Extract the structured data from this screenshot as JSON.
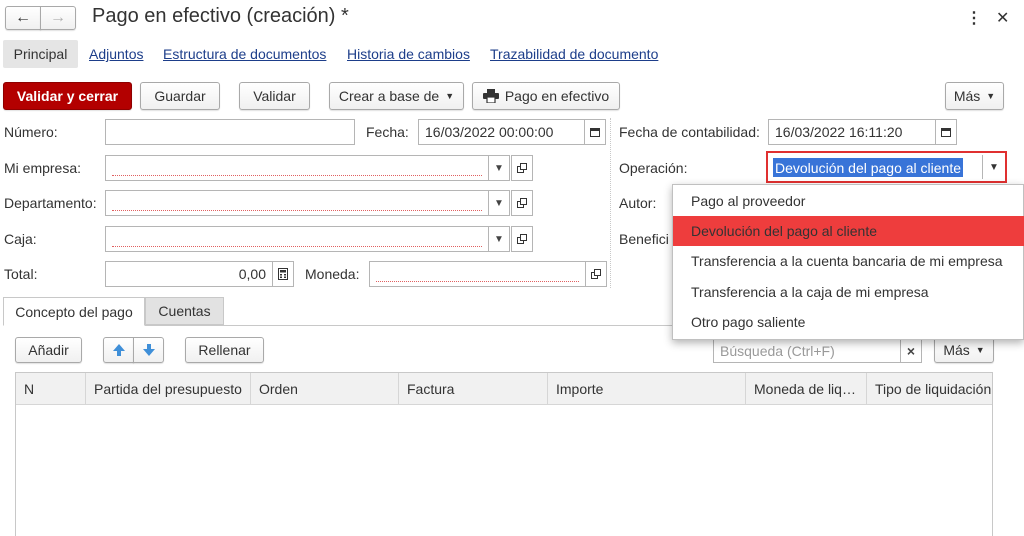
{
  "window": {
    "title": "Pago en efectivo (creación) *",
    "more_icon": "⋮",
    "close_icon": "✕"
  },
  "nav": {
    "back_icon": "←",
    "forward_icon": "→"
  },
  "tabs": [
    {
      "label": "Principal",
      "active": true
    },
    {
      "label": "Adjuntos"
    },
    {
      "label": "Estructura de documentos"
    },
    {
      "label": "Historia de cambios"
    },
    {
      "label": "Trazabilidad de documento"
    }
  ],
  "toolbar": {
    "validate_close": "Validar y cerrar",
    "save": "Guardar",
    "validate": "Validar",
    "create_based": "Crear a base de",
    "print_label": "Pago en efectivo",
    "more": "Más"
  },
  "form": {
    "numero_label": "Número:",
    "numero_value": "",
    "fecha_label": "Fecha:",
    "fecha_value": "16/03/2022 00:00:00",
    "empresa_label": "Mi empresa:",
    "departamento_label": "Departamento:",
    "caja_label": "Caja:",
    "total_label": "Total:",
    "total_value": "0,00",
    "moneda_label": "Moneda:",
    "fecha_contab_label": "Fecha de contabilidad:",
    "fecha_contab_value": "16/03/2022 16:11:20",
    "operacion_label": "Operación:",
    "operacion_value": "Devolución del pago al cliente",
    "autor_label": "Autor:",
    "beneficiario_label": "Benefici"
  },
  "dropdown": {
    "items": [
      "Pago al proveedor",
      "Devolución del pago al cliente",
      "Transferencia a la cuenta bancaria de mi empresa",
      "Transferencia a la caja de mi empresa",
      "Otro pago saliente"
    ],
    "selected_index": 1
  },
  "lower_tabs": [
    {
      "label": "Concepto del pago",
      "active": true
    },
    {
      "label": "Cuentas"
    }
  ],
  "table_toolbar": {
    "add": "Añadir",
    "fill": "Rellenar",
    "search_placeholder": "Búsqueda (Ctrl+F)",
    "clear_icon": "×",
    "more": "Más"
  },
  "table": {
    "columns": [
      "N",
      "Partida del presupuesto",
      "Orden",
      "Factura",
      "Importe",
      "Moneda de liq…",
      "Tipo de liquidación"
    ],
    "rows": []
  },
  "colors": {
    "primary": "#b30000",
    "selected_item": "#ee3d3d",
    "link": "#1d3e8a",
    "highlight": "#3874d8"
  }
}
